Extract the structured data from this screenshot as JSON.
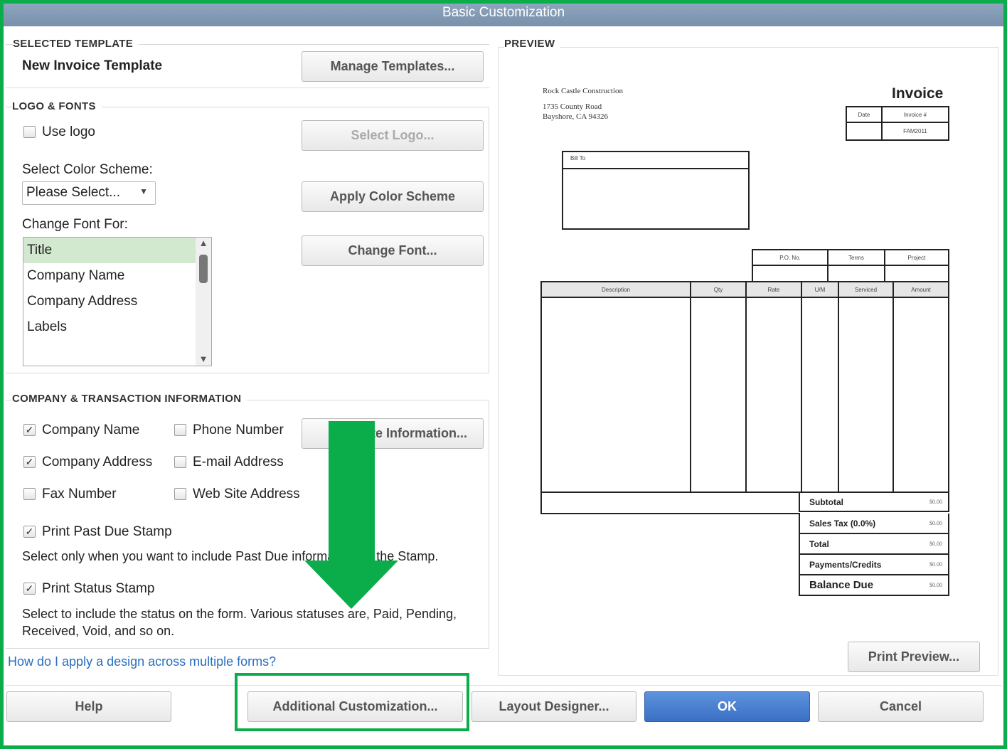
{
  "window": {
    "title": "Basic Customization"
  },
  "selected_template": {
    "heading": "SELECTED TEMPLATE",
    "name": "New Invoice Template",
    "manage_button": "Manage Templates..."
  },
  "logo_fonts": {
    "heading": "LOGO & FONTS",
    "use_logo": "Use logo",
    "use_logo_checked": false,
    "select_logo_button": "Select Logo...",
    "color_scheme_label": "Select Color Scheme:",
    "color_scheme_value": "Please Select...",
    "apply_color_button": "Apply Color Scheme",
    "change_font_label": "Change Font For:",
    "font_items": [
      "Title",
      "Company Name",
      "Company Address",
      "Labels"
    ],
    "selected_font_item": "Title",
    "change_font_button": "Change Font..."
  },
  "company_info": {
    "heading": "COMPANY & TRANSACTION INFORMATION",
    "checks": [
      {
        "label": "Company Name",
        "checked": true
      },
      {
        "label": "Phone Number",
        "checked": false
      },
      {
        "label": "Company Address",
        "checked": true
      },
      {
        "label": "E-mail Address",
        "checked": false
      },
      {
        "label": "Fax Number",
        "checked": false
      },
      {
        "label": "Web Site Address",
        "checked": false
      }
    ],
    "update_button": "Update Information...",
    "past_due": "Print Past Due Stamp",
    "past_due_checked": true,
    "past_due_help": "Select only when you want to include Past Due information on the Stamp.",
    "status": "Print Status Stamp",
    "status_checked": true,
    "status_help": "Select to include the status on the form. Various statuses are, Paid, Pending, Received, Void, and so on."
  },
  "help_link": "How do I apply a design across multiple forms?",
  "preview": {
    "heading": "PREVIEW",
    "company": "Rock Castle Construction",
    "address1": "1735 County Road",
    "address2": "Bayshore, CA 94326",
    "doc_title": "Invoice",
    "date_label": "Date",
    "invoice_no_label": "Invoice #",
    "invoice_no": "FAM2011",
    "bill_to": "Bill To",
    "po": "P.O. No.",
    "terms": "Terms",
    "project": "Project",
    "columns": [
      "Description",
      "Qty",
      "Rate",
      "U/M",
      "Serviced",
      "Amount"
    ],
    "totals": [
      {
        "label": "Subtotal",
        "value": "$0.00"
      },
      {
        "label": "Sales Tax  (0.0%)",
        "value": "$0.00"
      },
      {
        "label": "Total",
        "value": "$0.00"
      },
      {
        "label": "Payments/Credits",
        "value": "$0.00"
      },
      {
        "label": "Balance Due",
        "value": "$0.00"
      }
    ],
    "print_preview_button": "Print Preview..."
  },
  "footer": {
    "help": "Help",
    "additional": "Additional Customization...",
    "layout": "Layout Designer...",
    "ok": "OK",
    "cancel": "Cancel"
  },
  "colors": {
    "highlight": "#0aad4a",
    "title_bar": "#8299b2",
    "ok": "#4a80d2"
  }
}
